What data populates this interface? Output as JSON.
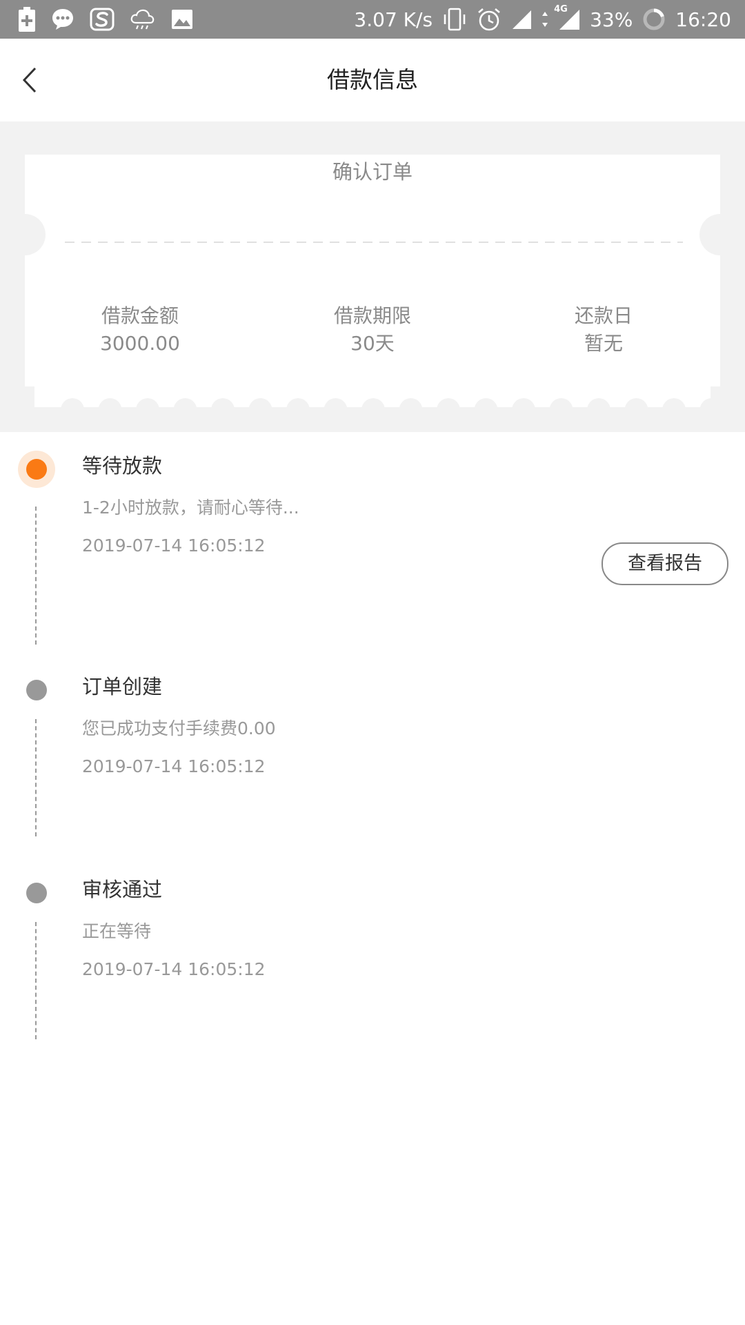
{
  "status_bar": {
    "net_speed": "3.07 K/s",
    "network": "4G",
    "battery": "33%",
    "time": "16:20"
  },
  "nav": {
    "title": "借款信息"
  },
  "ticket": {
    "heading": "确认订单",
    "columns": [
      {
        "label": "借款金额",
        "value": "3000.00"
      },
      {
        "label": "借款期限",
        "value": "30天"
      },
      {
        "label": "还款日",
        "value": "暂无"
      }
    ]
  },
  "timeline": [
    {
      "title": "等待放款",
      "desc": "1-2小时放款，请耐心等待...",
      "time": "2019-07-14 16:05:12",
      "active": true,
      "button": "查看报告"
    },
    {
      "title": "订单创建",
      "desc": "您已成功支付手续费0.00",
      "time": "2019-07-14 16:05:12",
      "active": false
    },
    {
      "title": "审核通过",
      "desc": "正在等待",
      "time": "2019-07-14 16:05:12",
      "active": false
    }
  ],
  "colors": {
    "accent": "#fa7a14",
    "status_bar_bg": "#8c8c8c",
    "section_bg": "#f2f2f2"
  }
}
